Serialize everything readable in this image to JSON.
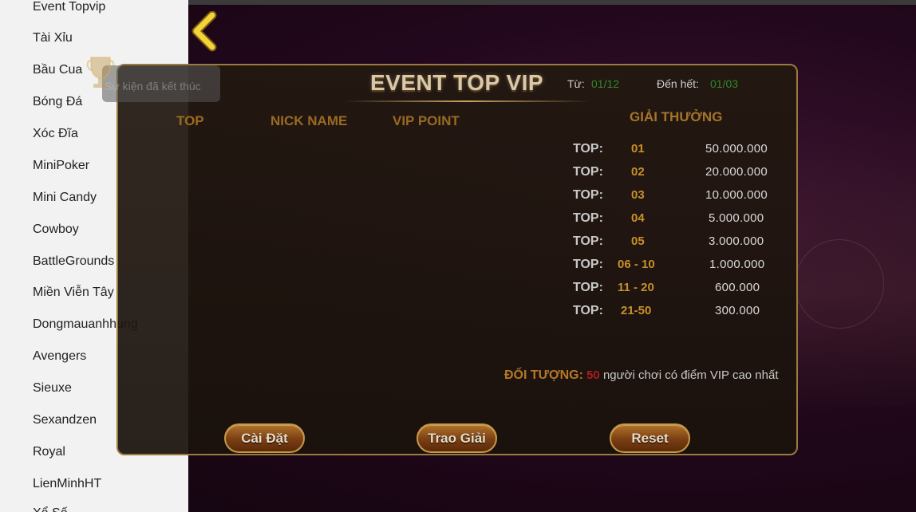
{
  "sidebar": {
    "items": [
      {
        "label": "Event Topvip",
        "top": -1
      },
      {
        "label": "Tài Xỉu"
      },
      {
        "label": "Bầu Cua"
      },
      {
        "label": "Bóng Đá"
      },
      {
        "label": "Xóc Đĩa"
      },
      {
        "label": "MiniPoker"
      },
      {
        "label": "Mini Candy"
      },
      {
        "label": "Cowboy"
      },
      {
        "label": "BattleGrounds"
      },
      {
        "label": "Miền Viễn Tây"
      },
      {
        "label": "Dongmauanhhung"
      },
      {
        "label": "Avengers"
      },
      {
        "label": "Sieuxe"
      },
      {
        "label": "Sexandzen"
      },
      {
        "label": "Royal"
      },
      {
        "label": "LienMinhHT"
      },
      {
        "label": "Xổ Số"
      }
    ]
  },
  "panel": {
    "ended_text": "Sự kiện đã kết thúc",
    "title": "EVENT TOP VIP",
    "from_label": "Từ:",
    "from_value": "01/12",
    "to_label": "Đến hết:",
    "to_value": "01/03",
    "columns": [
      "TOP",
      "NICK NAME",
      "VIP POINT"
    ],
    "prize_header": "GIẢI THƯỞNG",
    "prizes": [
      {
        "label": "TOP:",
        "rank": "01",
        "amount": "50.000.000"
      },
      {
        "label": "TOP:",
        "rank": "02",
        "amount": "20.000.000"
      },
      {
        "label": "TOP:",
        "rank": "03",
        "amount": "10.000.000"
      },
      {
        "label": "TOP:",
        "rank": "04",
        "amount": "5.000.000"
      },
      {
        "label": "TOP:",
        "rank": "05",
        "amount": "3.000.000"
      },
      {
        "label": "TOP:",
        "rank": "06 - 10",
        "amount": "1.000.000"
      },
      {
        "label": "TOP:",
        "rank": "11 - 20",
        "amount": "600.000"
      },
      {
        "label": "TOP:",
        "rank": "21-50",
        "amount": "300.000"
      }
    ],
    "target_label": "ĐỐI TƯỢNG:",
    "target_number": "50",
    "target_text": "người chơi có điểm VIP cao nhất",
    "buttons": {
      "settings": "Cài Đặt",
      "award": "Trao Giải",
      "reset": "Reset"
    }
  },
  "icons": {
    "back": "chevron-left-icon",
    "trophy": "trophy-icon"
  },
  "colors": {
    "accent_gold": "#c8902a",
    "date_green": "#2f8a2a",
    "target_red": "#a81e1e"
  }
}
